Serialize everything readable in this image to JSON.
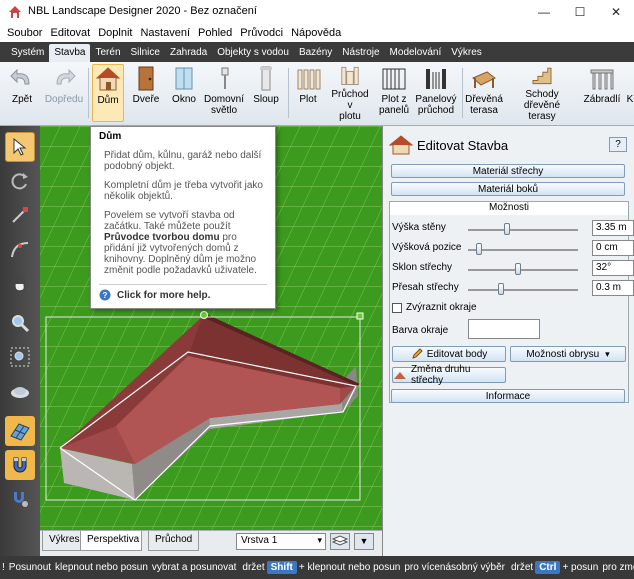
{
  "window": {
    "title": "NBL Landscape Designer 2020 - Bez označení",
    "minimize": "—",
    "maximize": "☐",
    "close": "✕"
  },
  "menu": [
    "Soubor",
    "Editovat",
    "Doplnit",
    "Nastavení",
    "Pohled",
    "Průvodci",
    "Nápověda"
  ],
  "ribbon_tabs": [
    "Systém",
    "Stavba",
    "Terén",
    "Silnice",
    "Zahrada",
    "Objekty s vodou",
    "Bazény",
    "Nástroje",
    "Modelování",
    "Výkres"
  ],
  "ribbon_active": "Stavba",
  "toolbar": {
    "zpet": "Zpět",
    "dopredu": "Dopředu",
    "dum": "Dům",
    "dvere": "Dveře",
    "okno": "Okno",
    "svetlo_1": "Domovní",
    "svetlo_2": "světlo",
    "sloup": "Sloup",
    "plot": "Plot",
    "pruchod_1": "Průchod v",
    "pruchod_2": "plotu",
    "plotz_1": "Plot z",
    "plotz_2": "panelů",
    "panel_1": "Panelový",
    "panel_2": "průchod",
    "drev_1": "Dřevěná",
    "drev_2": "terasa",
    "schody_1": "Schody dřevěné",
    "schody_2": "terasy",
    "zabradli": "Zábradlí",
    "extra": "K"
  },
  "tooltip": {
    "title": "Dům",
    "p1": "Přidat dům, kůlnu, garáž nebo další podobný objekt.",
    "p2": "Kompletní dům je třeba vytvořit jako několik objektů.",
    "p3a": "Povelem se vytvoří stavba od začátku. Také můžete použít",
    "p3b": "Průvodce tvorbou domu",
    "p3c": "pro přidání již vytvořených domů z knihovny. Doplněný dům je možno změnit podle požadavků uživatele.",
    "help": "Click for more help."
  },
  "view_tabs": [
    "Výkres",
    "Perspektiva",
    "Průchod"
  ],
  "view_active": "Perspektiva",
  "layer_select": "Vrstva 1",
  "panel": {
    "title": "Editovat Stavba",
    "help": "?",
    "btn_material_roof": "Materiál střechy",
    "btn_material_sides": "Materiál boků",
    "section_options": "Možnosti",
    "height_label": "Výška stěny",
    "height_value": "3.35 m",
    "pos_label": "Výšková pozice",
    "pos_value": "0 cm",
    "slope_label": "Sklon střechy",
    "slope_value": "32°",
    "overhang_label": "Přesah střechy",
    "overhang_value": "0.3 m",
    "highlight_label": "Zvýraznit okraje",
    "edge_color_label": "Barva okraje",
    "btn_edit_body": "Editovat body",
    "btn_outline": "Možnosti obrysu",
    "btn_roof_type": "Změna druhu střechy",
    "btn_info": "Informace"
  },
  "slider_levels": {
    "height": 0.35,
    "pos": 0.1,
    "slope": 0.45,
    "overhang": 0.3
  },
  "status": {
    "s1": "Posunout",
    "s2": "klepnout nebo posun",
    "s3": "vybrat a posunovat",
    "s4": "držet",
    "k1": "Shift",
    "s5": "+ klepnout nebo posun",
    "s6": "pro vícenásobný výběr",
    "s7": "držet",
    "k2": "Ctrl",
    "s8": "+ posun",
    "s9": "pro změ"
  },
  "colors": {
    "ribbon_dark": "#3b3b3b",
    "roof": "#8b3a3a",
    "grass": "#3c9a1e",
    "accent": "#3a78c4"
  }
}
